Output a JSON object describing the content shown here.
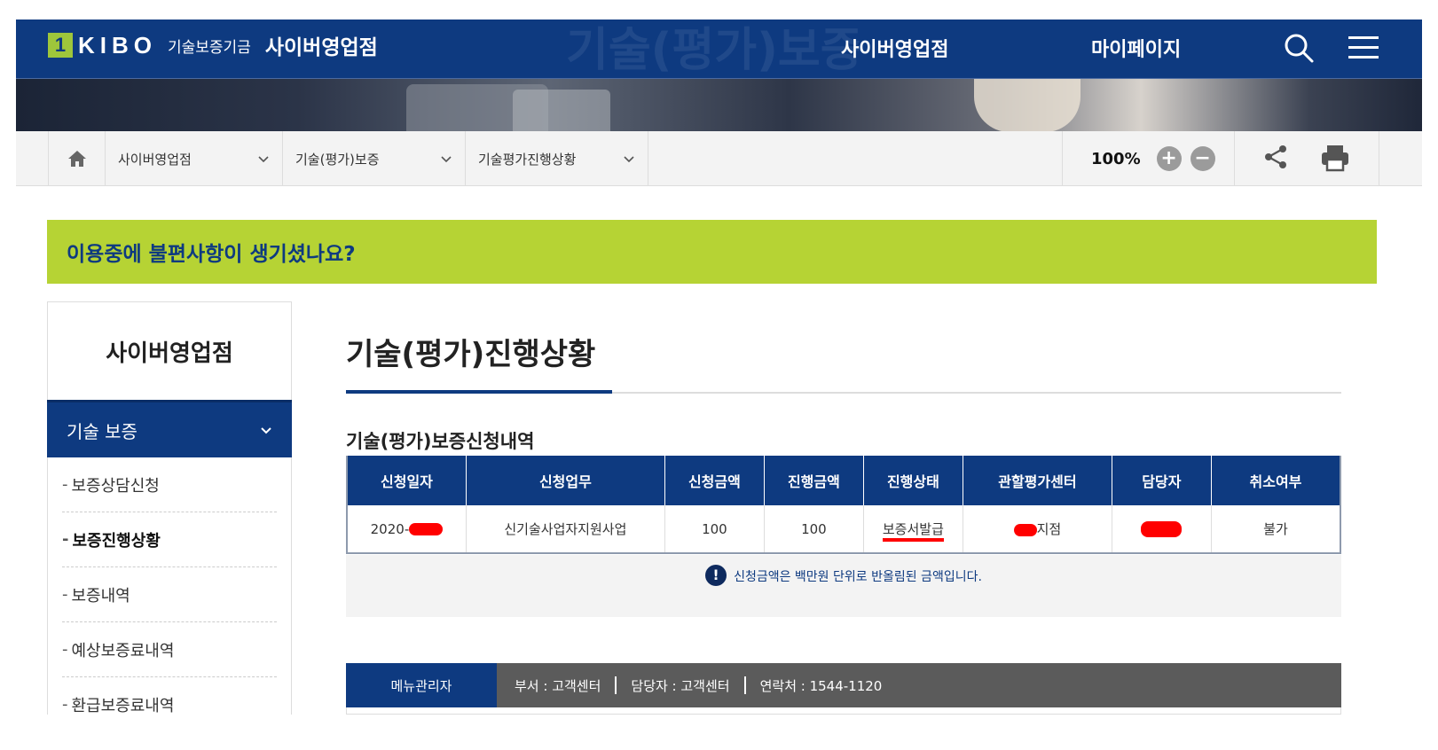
{
  "header": {
    "logo_mark": "1",
    "logo_brand": "KIBO",
    "logo_org": "기술보증기금",
    "logo_service": "사이버영업점",
    "nav_cyber": "사이버영업점",
    "nav_mypage": "마이페이지",
    "bg_text": "기술(평가)보증"
  },
  "location": {
    "items": [
      "사이버영업점",
      "기술(평가)보증",
      "기술평가진행상황"
    ],
    "zoom": "100%",
    "zoom_in": "+",
    "zoom_out": "−"
  },
  "notice": {
    "text": "이용중에 불편사항이 생기셨나요?"
  },
  "sidebar": {
    "title": "사이버영업점",
    "category": "기술 보증",
    "items": [
      {
        "label": "보증상담신청",
        "active": false
      },
      {
        "label": "보증진행상황",
        "active": true
      },
      {
        "label": "보증내역",
        "active": false
      },
      {
        "label": "예상보증료내역",
        "active": false
      },
      {
        "label": "환급보증료내역",
        "active": false
      }
    ]
  },
  "main": {
    "page_title": "기술(평가)진행상황",
    "section_title": "기술(평가)보증신청내역",
    "table": {
      "headers": [
        "신청일자",
        "신청업무",
        "신청금액",
        "진행금액",
        "진행상태",
        "관할평가센터",
        "담당자",
        "취소여부"
      ],
      "rows": [
        {
          "date": "2020-",
          "business": "신기술사업자지원사업",
          "request_amount": "100",
          "progress_amount": "100",
          "status": "보증서발급",
          "center": "지점",
          "manager": "",
          "cancel": "불가"
        }
      ]
    },
    "info": {
      "icon": "!",
      "text": "신청금액은 백만원 단위로 반올림된 금액입니다."
    },
    "manager_bar": {
      "label": "메뉴관리자",
      "dept": "부서 : 고객센터",
      "person": "담당자 : 고객센터",
      "contact": "연락처 : 1544-1120"
    }
  },
  "colors": {
    "navy": "#0e3a80",
    "lime": "#b6d334",
    "redaction": "#ff0000"
  },
  "icons": [
    "home-icon",
    "chevron-down-icon",
    "search-icon",
    "hamburger-menu-icon",
    "share-icon",
    "print-icon",
    "info-icon"
  ]
}
